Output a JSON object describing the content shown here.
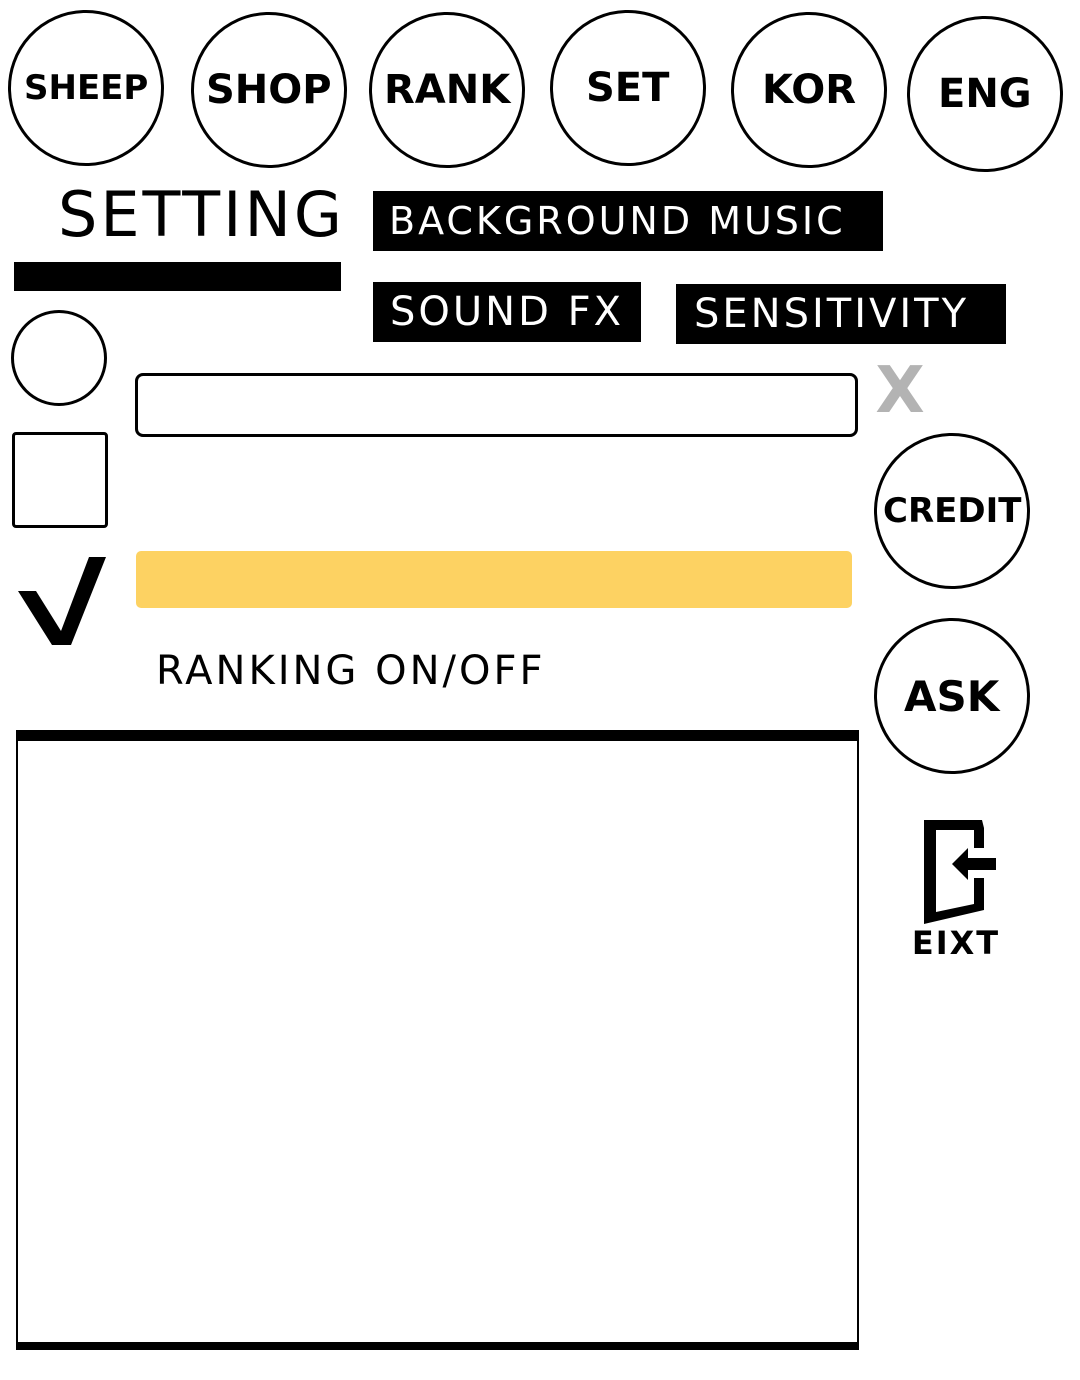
{
  "top_nav": {
    "sheep": "SHEEP",
    "shop": "SHOP",
    "rank": "RANK",
    "set": "SET",
    "kor": "KOR",
    "eng": "ENG"
  },
  "setting": {
    "title": "SETTING",
    "background_music": "BACKGROUND MUSIC",
    "sound_fx": "SOUND FX",
    "sensitivity": "SENSITIVITY",
    "close_label": "X",
    "input_value": "",
    "slider_color": "#fdd262",
    "ranking_toggle": "RANKING ON/OFF"
  },
  "side": {
    "credit": "CREDIT",
    "ask": "ASK",
    "exit": "EIXT"
  },
  "icons": {
    "check": "check-mark-icon",
    "exit": "exit-door-icon",
    "close": "close-icon"
  }
}
